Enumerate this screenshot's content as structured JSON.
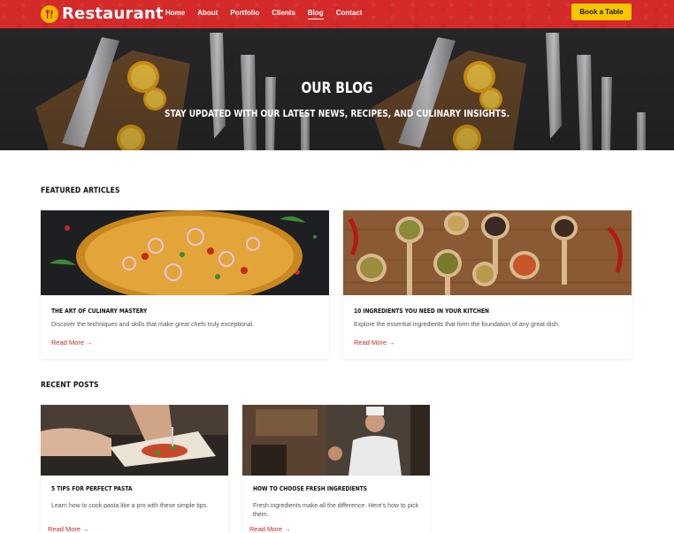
{
  "nav": {
    "brand": "Restaurant",
    "links": [
      "Home",
      "About",
      "Portfolio",
      "Clients",
      "Blog",
      "Contact"
    ],
    "active": "Blog",
    "book_button": "Book a Table"
  },
  "hero": {
    "title": "OUR BLOG",
    "subtitle": "STAY UPDATED WITH OUR LATEST NEWS, RECIPES, AND CULINARY INSIGHTS."
  },
  "featured": {
    "heading": "FEATURED ARTICLES",
    "articles": [
      {
        "title": "THE ART OF CULINARY MASTERY",
        "text": "Discover the techniques and skills that make great chefs truly exceptional.",
        "link": "Read More →"
      },
      {
        "title": "10 INGREDIENTS YOU NEED IN YOUR KITCHEN",
        "text": "Explore the essential ingredients that form the foundation of any great dish.",
        "link": "Read More →"
      }
    ]
  },
  "recent": {
    "heading": "RECENT POSTS",
    "posts": [
      {
        "title": "5 TIPS FOR PERFECT PASTA",
        "text": "Learn how to cook pasta like a pro with these simple tips.",
        "link": "Read More →"
      },
      {
        "title": "HOW TO CHOOSE FRESH INGREDIENTS",
        "text": "Fresh ingredients make all the difference. Here's how to pick them.",
        "link": "Read More →"
      }
    ]
  },
  "colors": {
    "nav_red": "#d42a2a",
    "accent_yellow": "#f7c600",
    "link_red": "#c6281f"
  },
  "icons": {
    "brand_logo": "fork-knife-icon"
  }
}
